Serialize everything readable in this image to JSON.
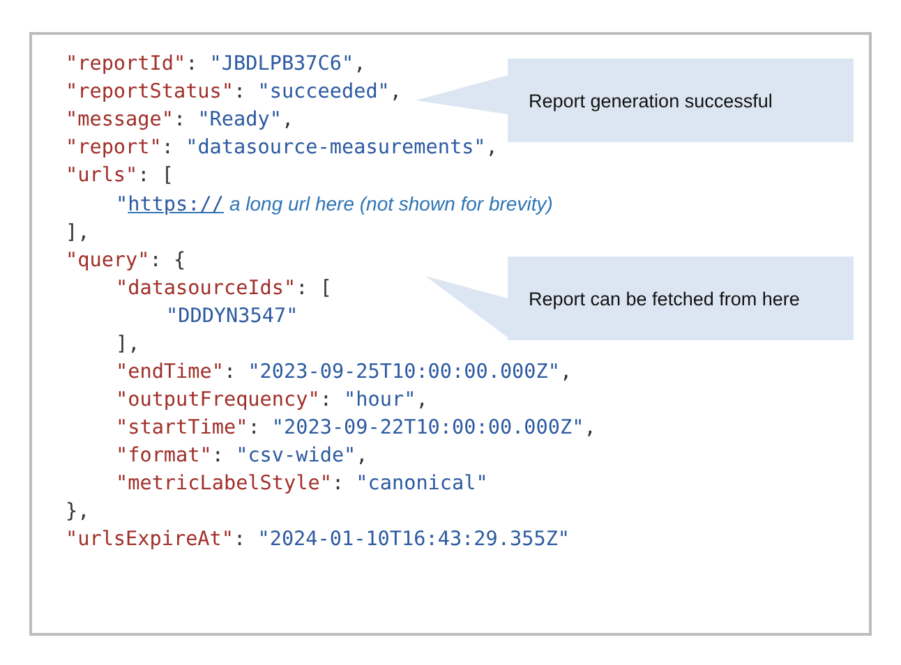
{
  "code_lines": [
    {
      "tokens": [
        {
          "kind": "key",
          "text": "\"reportId\""
        },
        {
          "kind": "punct",
          "text": ": "
        },
        {
          "kind": "string",
          "text": "\"JBDLPB37C6\""
        },
        {
          "kind": "punct",
          "text": ","
        }
      ]
    },
    {
      "tokens": [
        {
          "kind": "key",
          "text": "\"reportStatus\""
        },
        {
          "kind": "punct",
          "text": ": "
        },
        {
          "kind": "string",
          "text": "\"succeeded\""
        },
        {
          "kind": "punct",
          "text": ","
        }
      ]
    },
    {
      "tokens": [
        {
          "kind": "key",
          "text": "\"message\""
        },
        {
          "kind": "punct",
          "text": ": "
        },
        {
          "kind": "string",
          "text": "\"Ready\""
        },
        {
          "kind": "punct",
          "text": ","
        }
      ]
    },
    {
      "tokens": [
        {
          "kind": "key",
          "text": "\"report\""
        },
        {
          "kind": "punct",
          "text": ": "
        },
        {
          "kind": "string",
          "text": "\"datasource-measurements\""
        },
        {
          "kind": "punct",
          "text": ","
        }
      ]
    },
    {
      "tokens": [
        {
          "kind": "key",
          "text": "\"urls\""
        },
        {
          "kind": "punct",
          "text": ": ["
        }
      ],
      "children": [
        {
          "tokens": [
            {
              "kind": "string",
              "text": "\""
            },
            {
              "kind": "link",
              "text": "https://"
            },
            {
              "kind": "note",
              "text": "a long url here (not shown for brevity)"
            }
          ]
        }
      ]
    },
    {
      "tokens": [
        {
          "kind": "punct",
          "text": "],"
        }
      ]
    },
    {
      "tokens": [
        {
          "kind": "key",
          "text": "\"query\""
        },
        {
          "kind": "punct",
          "text": ": {"
        }
      ],
      "children": [
        {
          "tokens": [
            {
              "kind": "key",
              "text": "\"datasourceIds\""
            },
            {
              "kind": "punct",
              "text": ": ["
            }
          ],
          "children": [
            {
              "tokens": [
                {
                  "kind": "string",
                  "text": "\"DDDYN3547\""
                }
              ]
            }
          ]
        },
        {
          "tokens": [
            {
              "kind": "punct",
              "text": "],"
            }
          ]
        },
        {
          "tokens": [
            {
              "kind": "key",
              "text": "\"endTime\""
            },
            {
              "kind": "punct",
              "text": ": "
            },
            {
              "kind": "string",
              "text": "\"2023-09-25T10:00:00.000Z\""
            },
            {
              "kind": "punct",
              "text": ","
            }
          ]
        },
        {
          "tokens": [
            {
              "kind": "key",
              "text": "\"outputFrequency\""
            },
            {
              "kind": "punct",
              "text": ": "
            },
            {
              "kind": "string",
              "text": "\"hour\""
            },
            {
              "kind": "punct",
              "text": ","
            }
          ]
        },
        {
          "tokens": [
            {
              "kind": "key",
              "text": "\"startTime\""
            },
            {
              "kind": "punct",
              "text": ": "
            },
            {
              "kind": "string",
              "text": "\"2023-09-22T10:00:00.000Z\""
            },
            {
              "kind": "punct",
              "text": ","
            }
          ]
        },
        {
          "tokens": [
            {
              "kind": "key",
              "text": "\"format\""
            },
            {
              "kind": "punct",
              "text": ": "
            },
            {
              "kind": "string",
              "text": "\"csv-wide\""
            },
            {
              "kind": "punct",
              "text": ","
            }
          ]
        },
        {
          "tokens": [
            {
              "kind": "key",
              "text": "\"metricLabelStyle\""
            },
            {
              "kind": "punct",
              "text": ": "
            },
            {
              "kind": "string",
              "text": "\"canonical\""
            }
          ]
        }
      ]
    },
    {
      "tokens": [
        {
          "kind": "punct",
          "text": "},"
        }
      ]
    },
    {
      "tokens": [
        {
          "kind": "key",
          "text": "\"urlsExpireAt\""
        },
        {
          "kind": "punct",
          "text": ": "
        },
        {
          "kind": "string",
          "text": "\"2024-01-10T16:43:29.355Z\""
        }
      ]
    }
  ],
  "callouts": [
    {
      "text": "Report generation successful"
    },
    {
      "text": "Report can be fetched from here"
    }
  ]
}
